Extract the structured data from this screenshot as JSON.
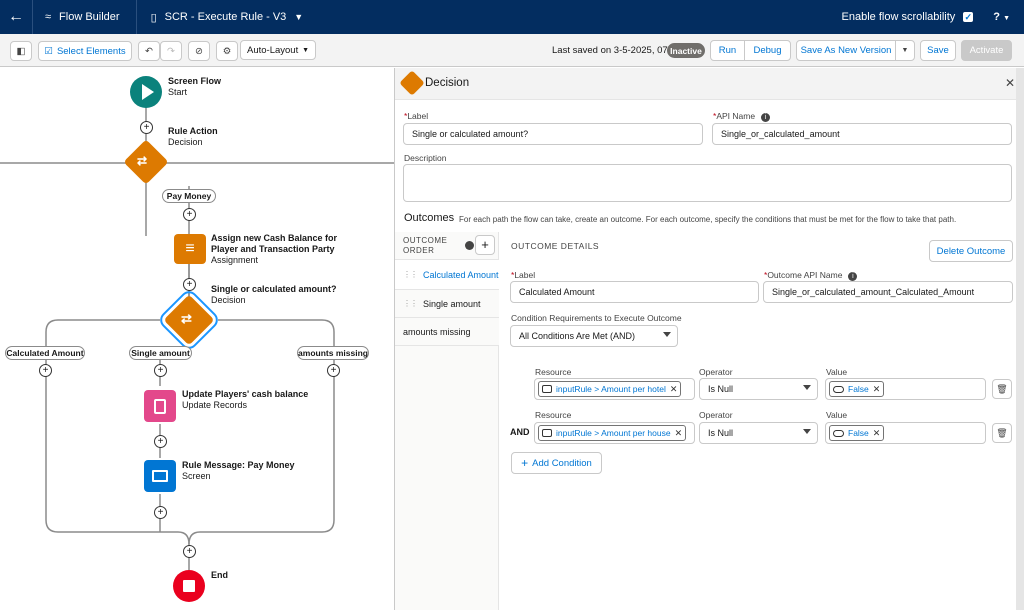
{
  "topbar": {
    "app_name": "Flow Builder",
    "flow_name": "SCR - Execute Rule - V3",
    "scroll_label": "Enable flow scrollability",
    "help": "?"
  },
  "toolbar": {
    "select_elements": "Select Elements",
    "layout": "Auto-Layout",
    "last_saved": "Last saved on 3-5-2025, 07:06",
    "status": "Inactive",
    "run": "Run",
    "debug": "Debug",
    "save_as_new": "Save As New Version",
    "save": "Save",
    "activate": "Activate"
  },
  "canvas": {
    "start_title": "Screen Flow",
    "start_sub": "Start",
    "rule_action_title": "Rule Action",
    "rule_action_sub": "Decision",
    "pay_money": "Pay Money",
    "assign_title": "Assign new Cash Balance for Player and Transaction Party",
    "assign_sub": "Assignment",
    "single_calc_title": "Single or calculated amount?",
    "single_calc_sub": "Decision",
    "branch_calculated": "Calculated Amount",
    "branch_single": "Single amount",
    "branch_missing": "amounts missing",
    "update_title": "Update Players' cash balance",
    "update_sub": "Update Records",
    "message_title": "Rule Message: Pay Money",
    "message_sub": "Screen",
    "end_title": "End"
  },
  "panel": {
    "title": "Decision",
    "label_label": "Label",
    "label_value": "Single or calculated amount?",
    "api_label": "API Name",
    "api_value": "Single_or_calculated_amount",
    "description_label": "Description",
    "outcomes_title": "Outcomes",
    "outcomes_help": "For each path the flow can take, create an outcome. For each outcome, specify the conditions that must be met for the flow to take that path.",
    "order_header": "OUTCOME ORDER",
    "order_items": [
      "Calculated Amount",
      "Single amount",
      "amounts missing"
    ],
    "details_header": "OUTCOME DETAILS",
    "delete_outcome": "Delete Outcome",
    "outcome_label_label": "Label",
    "outcome_label_value": "Calculated Amount",
    "outcome_api_label": "Outcome API Name",
    "outcome_api_value": "Single_or_calculated_amount_Calculated_Amount",
    "cond_req_label": "Condition Requirements to Execute Outcome",
    "cond_req_value": "All Conditions Are Met (AND)",
    "resource_label": "Resource",
    "operator_label": "Operator",
    "value_label": "Value",
    "and_label": "AND",
    "conditions": [
      {
        "resource": "inputRule > Amount per hotel",
        "operator": "Is Null",
        "value": "False"
      },
      {
        "resource": "inputRule > Amount per house",
        "operator": "Is Null",
        "value": "False"
      }
    ],
    "add_condition": "Add Condition"
  }
}
